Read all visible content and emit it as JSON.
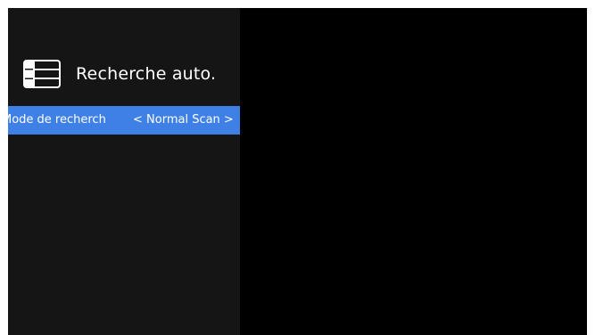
{
  "panel": {
    "icon": "list-menu-icon",
    "title": "Recherche auto."
  },
  "menu": {
    "items": [
      {
        "label": "Mode de recherch",
        "value": "< Normal Scan >",
        "selected": true
      }
    ]
  },
  "colors": {
    "background": "#000000",
    "panel_background": "#151515",
    "highlight": "#3f80e6",
    "text": "#ffffff"
  }
}
